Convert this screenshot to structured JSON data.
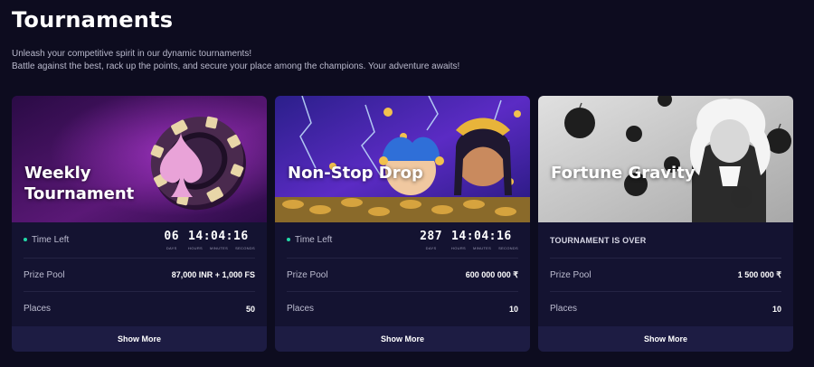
{
  "page": {
    "title": "Tournaments",
    "intro_line1": "Unleash your competitive spirit in our dynamic tournaments!",
    "intro_line2": "Battle against the best, rack up the points, and secure your place among the champions. Your adventure awaits!"
  },
  "labels": {
    "time_left": "Time Left",
    "prize_pool": "Prize Pool",
    "places": "Places",
    "show_more": "Show More",
    "days": "DAYS",
    "hours": "HOURS",
    "minutes": "MINUTES",
    "seconds": "SECONDS"
  },
  "cards": [
    {
      "title": "Weekly Tournament",
      "days": "06",
      "hms": "14:04:16",
      "prize": "87,000 INR + 1,000 FS",
      "places": "50"
    },
    {
      "title": "Non-Stop Drop",
      "days": "287",
      "hms": "14:04:16",
      "prize": "600 000 000 ₹",
      "places": "10"
    },
    {
      "title": "Fortune Gravity",
      "status": "TOURNAMENT IS OVER",
      "prize": "1 500 000 ₹",
      "places": "10"
    }
  ],
  "colors": {
    "background": "#0d0c1f",
    "card": "#141331",
    "button": "#1d1c43",
    "live_dot": "#23d9a8"
  }
}
